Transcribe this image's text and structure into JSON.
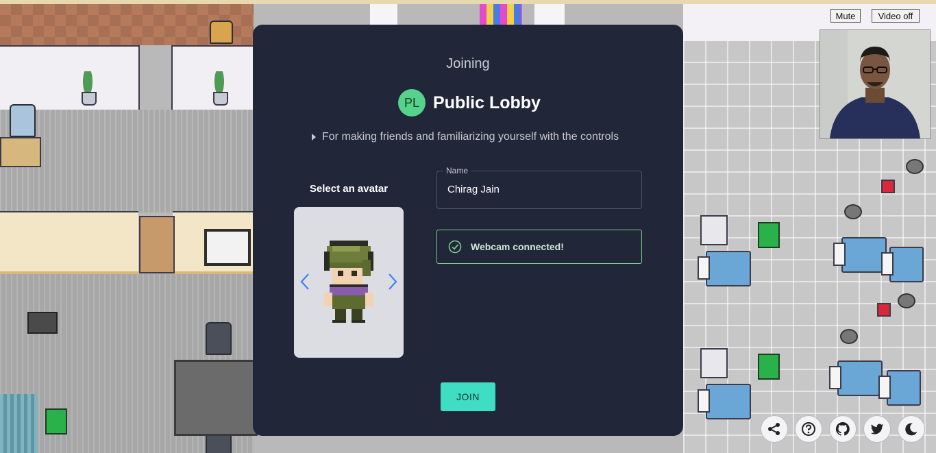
{
  "dialog": {
    "joining": "Joining",
    "room_initials": "PL",
    "room_name": "Public Lobby",
    "room_description": "For making friends and familiarizing yourself with the controls",
    "select_avatar_label": "Select an avatar",
    "name_label": "Name",
    "name_value": "Chirag Jain",
    "webcam_status": "Webcam connected!",
    "join_button": "JOIN"
  },
  "video_controls": {
    "mute": "Mute",
    "video_off": "Video off"
  },
  "toolbar": {
    "icons": [
      "share-icon",
      "help-icon",
      "github-icon",
      "twitter-icon",
      "dark-mode-icon"
    ]
  },
  "colors": {
    "dialog_bg": "#222639",
    "room_avatar": "#56d38a",
    "join_button": "#3fdec4",
    "webcam_border": "#7fc98f",
    "arrow": "#3b82f6"
  }
}
